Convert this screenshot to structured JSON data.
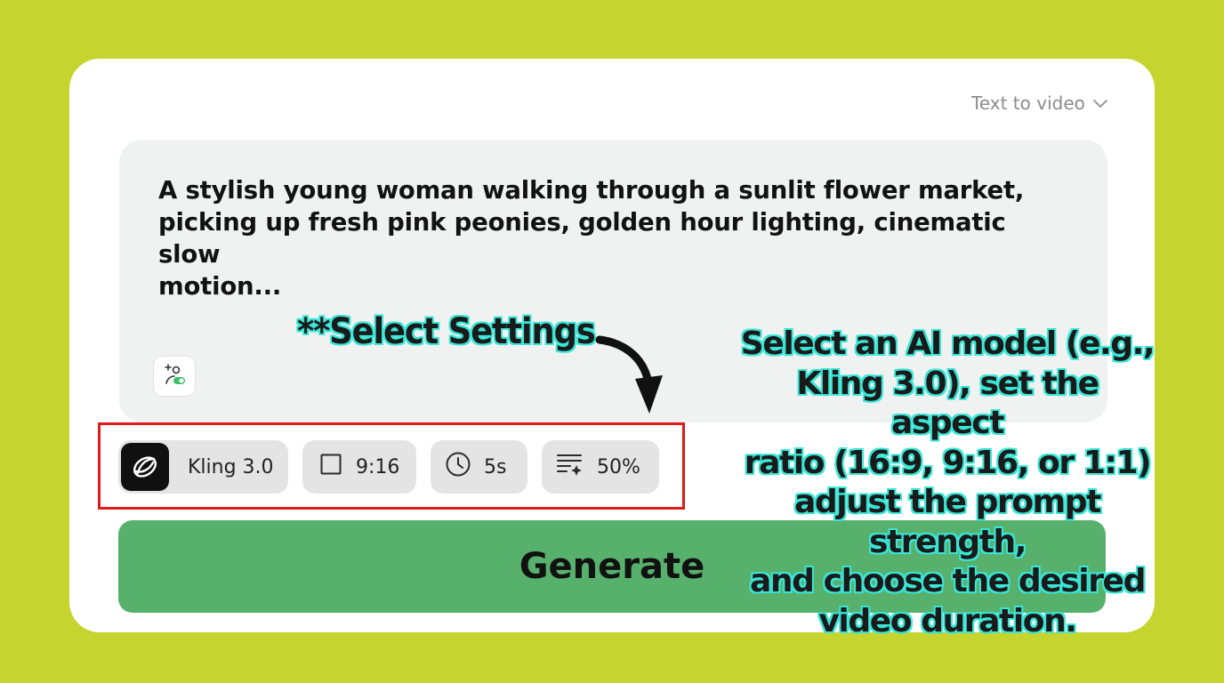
{
  "mode_select": {
    "label": "Text to video",
    "icon": "chevron-down-icon"
  },
  "prompt": {
    "text": "A stylish young woman walking through a sunlit flower market,\npicking up fresh pink peonies, golden hour lighting, cinematic slow\nmotion..."
  },
  "enhance_button": {
    "icon": "magic-enhance-icon"
  },
  "settings": {
    "model": {
      "label": "Kling 3.0",
      "icon": "kling-logo-icon"
    },
    "aspect_ratio": {
      "label": "9:16",
      "icon": "square-icon"
    },
    "duration": {
      "label": "5s",
      "icon": "clock-icon"
    },
    "prompt_strength": {
      "label": "50%",
      "icon": "sparkle-list-icon"
    }
  },
  "generate_button": {
    "label": "Generate",
    "color": "#57b16c"
  },
  "annotation": {
    "title": "**Select Settings",
    "body": "Select an AI model (e.g.,\nKling 3.0), set the aspect\nratio (16:9, 9:16, or 1:1)\nadjust the prompt strength,\nand choose the desired\nvideo duration.",
    "outline_color": "#39e6d6",
    "highlight_color": "#e01b1b"
  },
  "colors": {
    "background": "#c6d42f",
    "card": "#ffffff",
    "prompt_box": "#f0f1f1"
  }
}
